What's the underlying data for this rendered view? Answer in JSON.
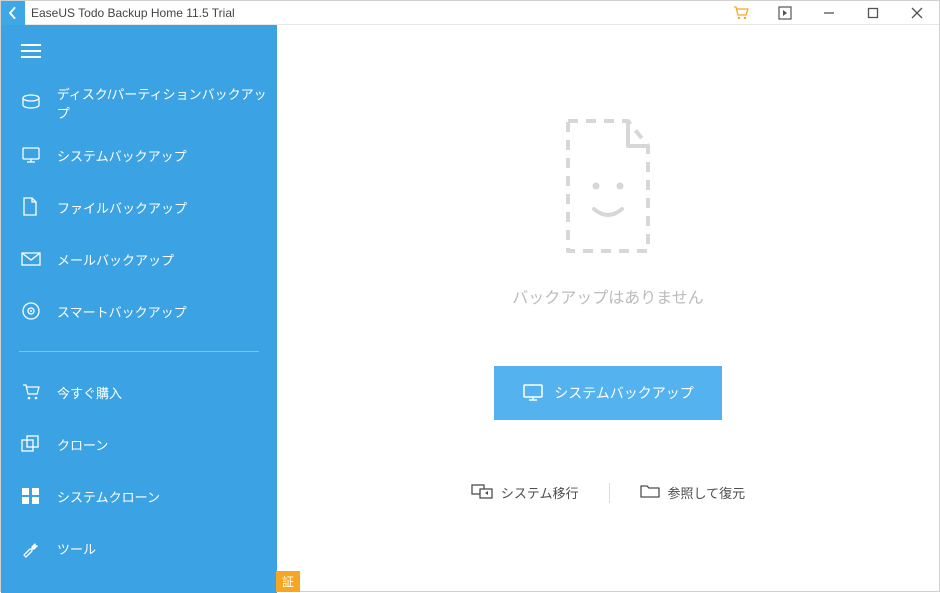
{
  "titlebar": {
    "title": "EaseUS Todo Backup Home 11.5 Trial"
  },
  "sidebar": {
    "items": [
      {
        "label": "ディスク/パーティションバックアップ"
      },
      {
        "label": "システムバックアップ"
      },
      {
        "label": "ファイルバックアップ"
      },
      {
        "label": "メールバックアップ"
      },
      {
        "label": "スマートバックアップ"
      }
    ],
    "items2": [
      {
        "label": "今すぐ購入"
      },
      {
        "label": "クローン"
      },
      {
        "label": "システムクローン"
      },
      {
        "label": "ツール"
      }
    ]
  },
  "main": {
    "empty_text": "バックアップはありません",
    "primary_button": "システムバックアップ",
    "system_transfer": "システム移行",
    "browse_restore": "参照して復元"
  },
  "auth_tag": "証"
}
